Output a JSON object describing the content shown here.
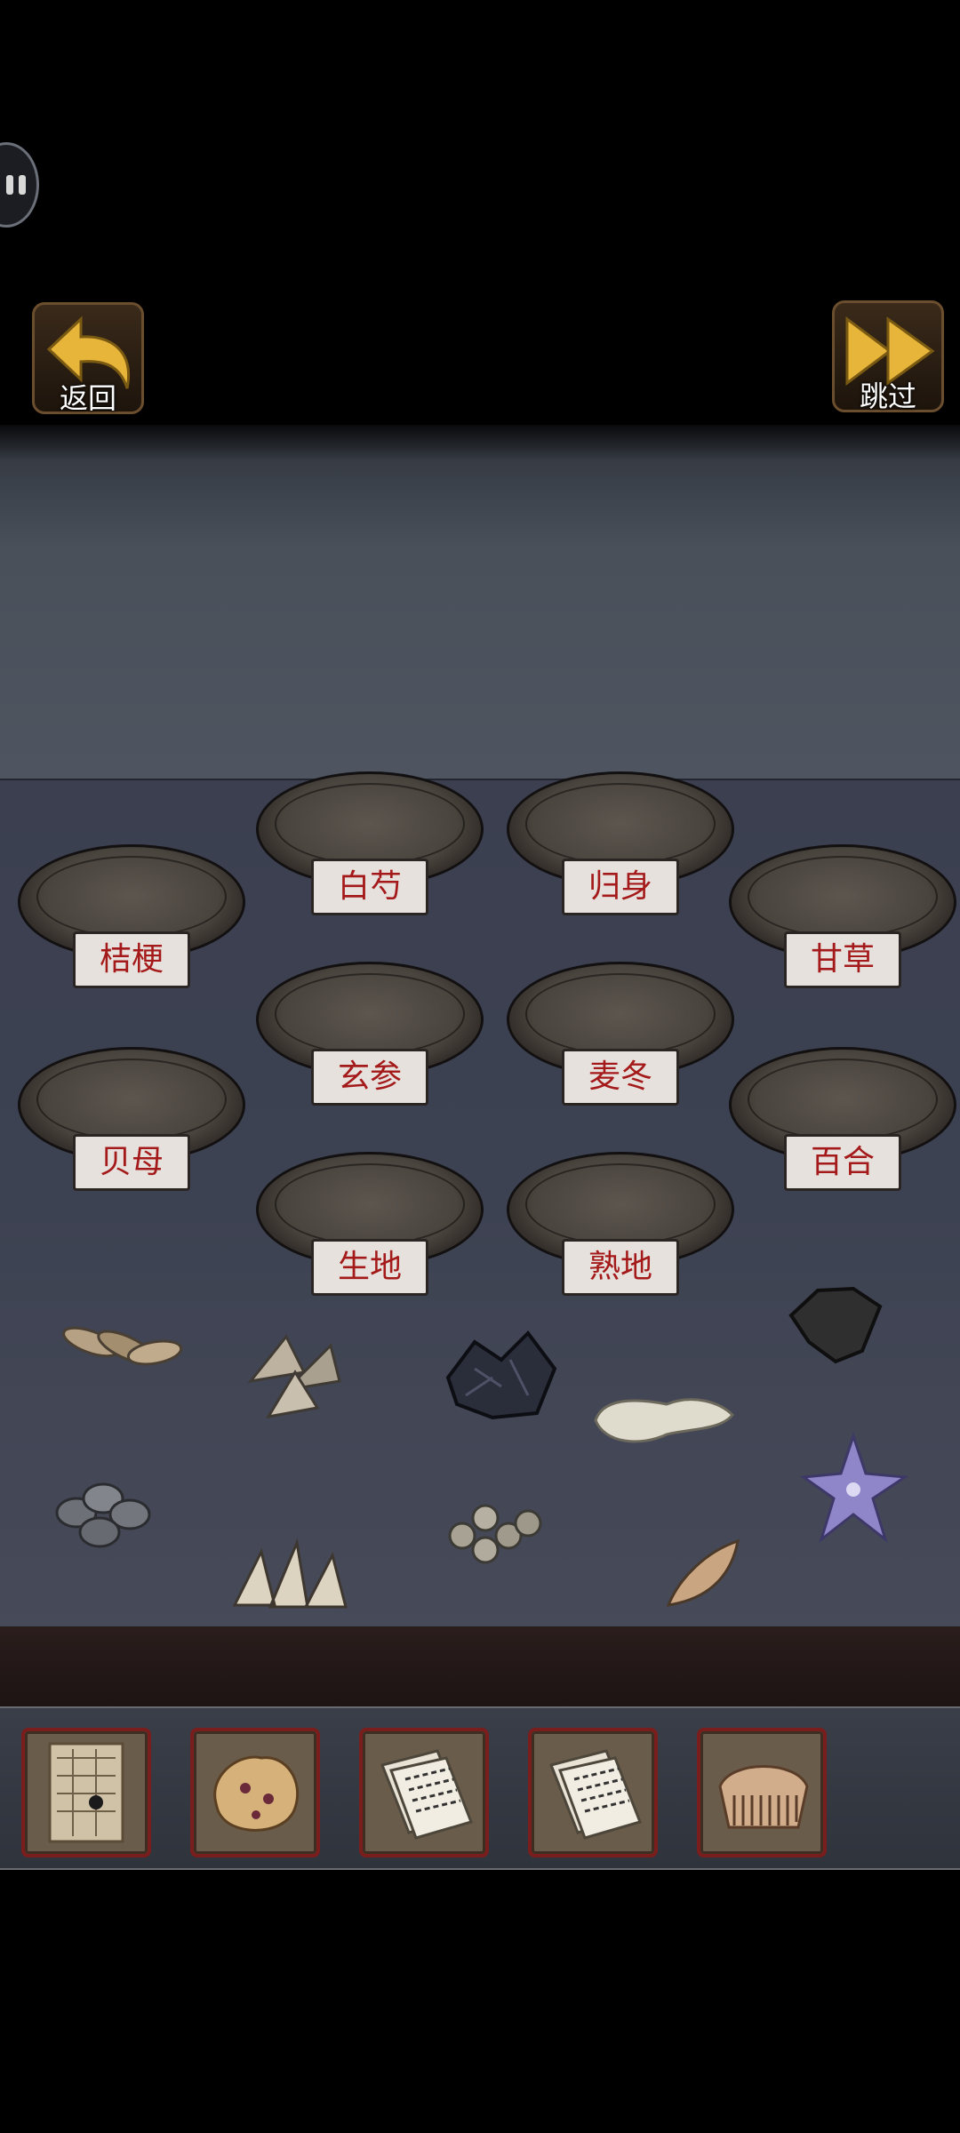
{
  "nav": {
    "back_label": "返回",
    "skip_label": "跳过"
  },
  "plates": {
    "baishao": "白芍",
    "guishen": "归身",
    "jiegeng": "桔梗",
    "gancao": "甘草",
    "xuanshen": "玄参",
    "maidong": "麦冬",
    "beimu": "贝母",
    "baihe": "百合",
    "shengdi": "生地",
    "shudi": "熟地"
  },
  "inventory": {
    "items": [
      "map-icon",
      "fungus-icon",
      "papers-icon",
      "papers-icon",
      "comb-icon"
    ]
  },
  "colors": {
    "label_red": "#a41a1a",
    "slot_border": "#7a1d1d",
    "nav_gold": "#e6b53a"
  }
}
